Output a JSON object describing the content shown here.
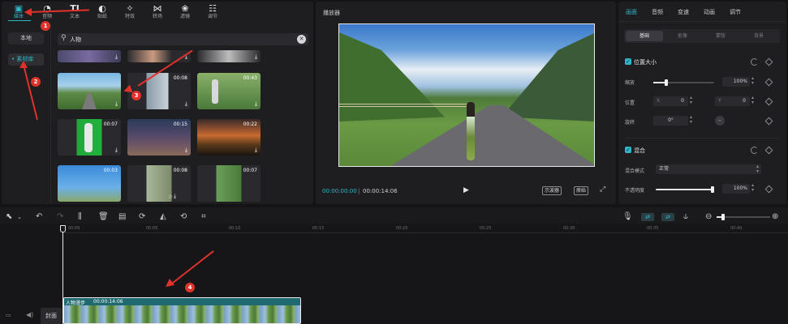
{
  "toolbar": {
    "tools": [
      {
        "label": "媒体",
        "icon": "media-icon"
      },
      {
        "label": "音频",
        "icon": "audio-icon"
      },
      {
        "label": "文本",
        "icon": "text-icon"
      },
      {
        "label": "贴纸",
        "icon": "sticker-icon"
      },
      {
        "label": "特效",
        "icon": "effects-icon"
      },
      {
        "label": "转场",
        "icon": "transition-icon"
      },
      {
        "label": "滤镜",
        "icon": "filter-icon"
      },
      {
        "label": "调节",
        "icon": "adjust-icon"
      }
    ]
  },
  "sidebar": {
    "local": "本地",
    "library": "素材库"
  },
  "search": {
    "value": "人物"
  },
  "media_grid": {
    "rows": [
      [
        "",
        "",
        ""
      ],
      [
        "",
        "00:08",
        "00:43"
      ],
      [
        "00:07",
        "00:15",
        "00:22"
      ],
      [
        "00:03",
        "00:08",
        "00:07"
      ]
    ]
  },
  "annotations": [
    "1",
    "2",
    "3",
    "4"
  ],
  "player": {
    "title": "播放器",
    "current_time": "00:00:00:00",
    "total_time": "00:00:14:06",
    "scope_button": "示波器",
    "ratio_button": "原始"
  },
  "props": {
    "tabs": [
      "画面",
      "音频",
      "变速",
      "动画",
      "调节"
    ],
    "subtabs": [
      "基础",
      "抠像",
      "蒙版",
      "背景"
    ],
    "section_position": "位置大小",
    "scale_label": "缩放",
    "scale_value": "100%",
    "position_label": "位置",
    "pos_x_label": "X",
    "pos_x": "0",
    "pos_y_label": "Y",
    "pos_y": "0",
    "rotate_label": "旋转",
    "rotate_value": "0°",
    "rotate_dash": "–",
    "section_blend": "混合",
    "blend_mode_label": "混合模式",
    "blend_mode_value": "正常",
    "opacity_label": "不透明度",
    "opacity_value": "100%"
  },
  "timeline": {
    "ticks": [
      "00:00",
      "00:05",
      "00:10",
      "00:15",
      "00:20",
      "00:25",
      "00:30",
      "00:35",
      "00:40"
    ],
    "clip_name": "人物漫步",
    "clip_duration": "00:00:14:06",
    "cover_label": "封面"
  },
  "colors": {
    "accent": "#2fb7c9",
    "annotation_red": "#e0312b"
  }
}
